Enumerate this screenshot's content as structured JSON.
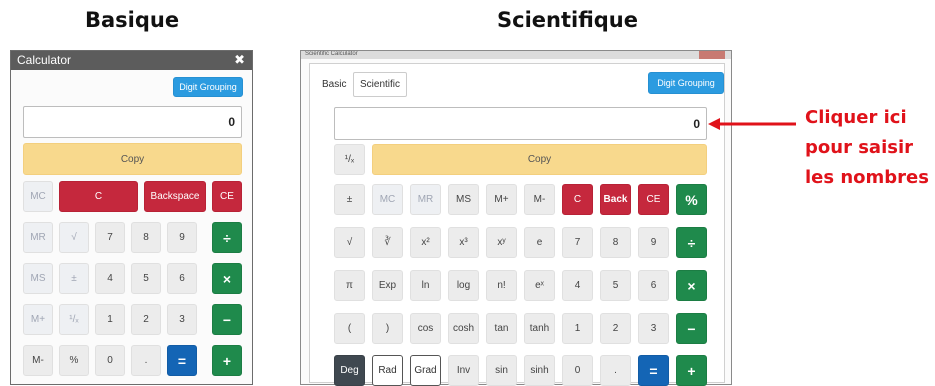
{
  "headings": {
    "basic": "Basique",
    "scientific": "Scientifique"
  },
  "basic": {
    "title": "Calculator",
    "close": "✖",
    "digit_grouping": "Digit Grouping",
    "display_value": "0",
    "copy": "Copy",
    "rows": [
      [
        "MC",
        "C",
        "Backspace",
        "CE"
      ],
      [
        "MR",
        "√",
        "7",
        "8",
        "9",
        "÷"
      ],
      [
        "MS",
        "±",
        "4",
        "5",
        "6",
        "×"
      ],
      [
        "M+",
        "¹/ₓ",
        "1",
        "2",
        "3",
        "−"
      ],
      [
        "M-",
        "%",
        "0",
        ".",
        "=",
        "+"
      ]
    ]
  },
  "scientific": {
    "window_title": "Scientific Calculator",
    "tabs": [
      "Basic",
      "Scientific"
    ],
    "digit_grouping": "Digit Grouping",
    "display_value": "0",
    "recip": "¹/ₓ",
    "copy": "Copy",
    "rows": [
      [
        "±",
        "MC",
        "MR",
        "MS",
        "M+",
        "M-",
        "C",
        "Back",
        "CE",
        "%"
      ],
      [
        "√",
        "∛",
        "x²",
        "x³",
        "xʸ",
        "e",
        "7",
        "8",
        "9",
        "÷"
      ],
      [
        "π",
        "Exp",
        "ln",
        "log",
        "n!",
        "eˣ",
        "4",
        "5",
        "6",
        "×"
      ],
      [
        "(",
        ")",
        "cos",
        "cosh",
        "tan",
        "tanh",
        "1",
        "2",
        "3",
        "−"
      ],
      [
        "Deg",
        "Rad",
        "Grad",
        "Inv",
        "sin",
        "sinh",
        "0",
        ".",
        "=",
        "+"
      ]
    ]
  },
  "annotation": {
    "line1": "Cliquer ici",
    "line2": "pour saisir",
    "line3": "les nombres",
    "color": "#e0121a"
  }
}
